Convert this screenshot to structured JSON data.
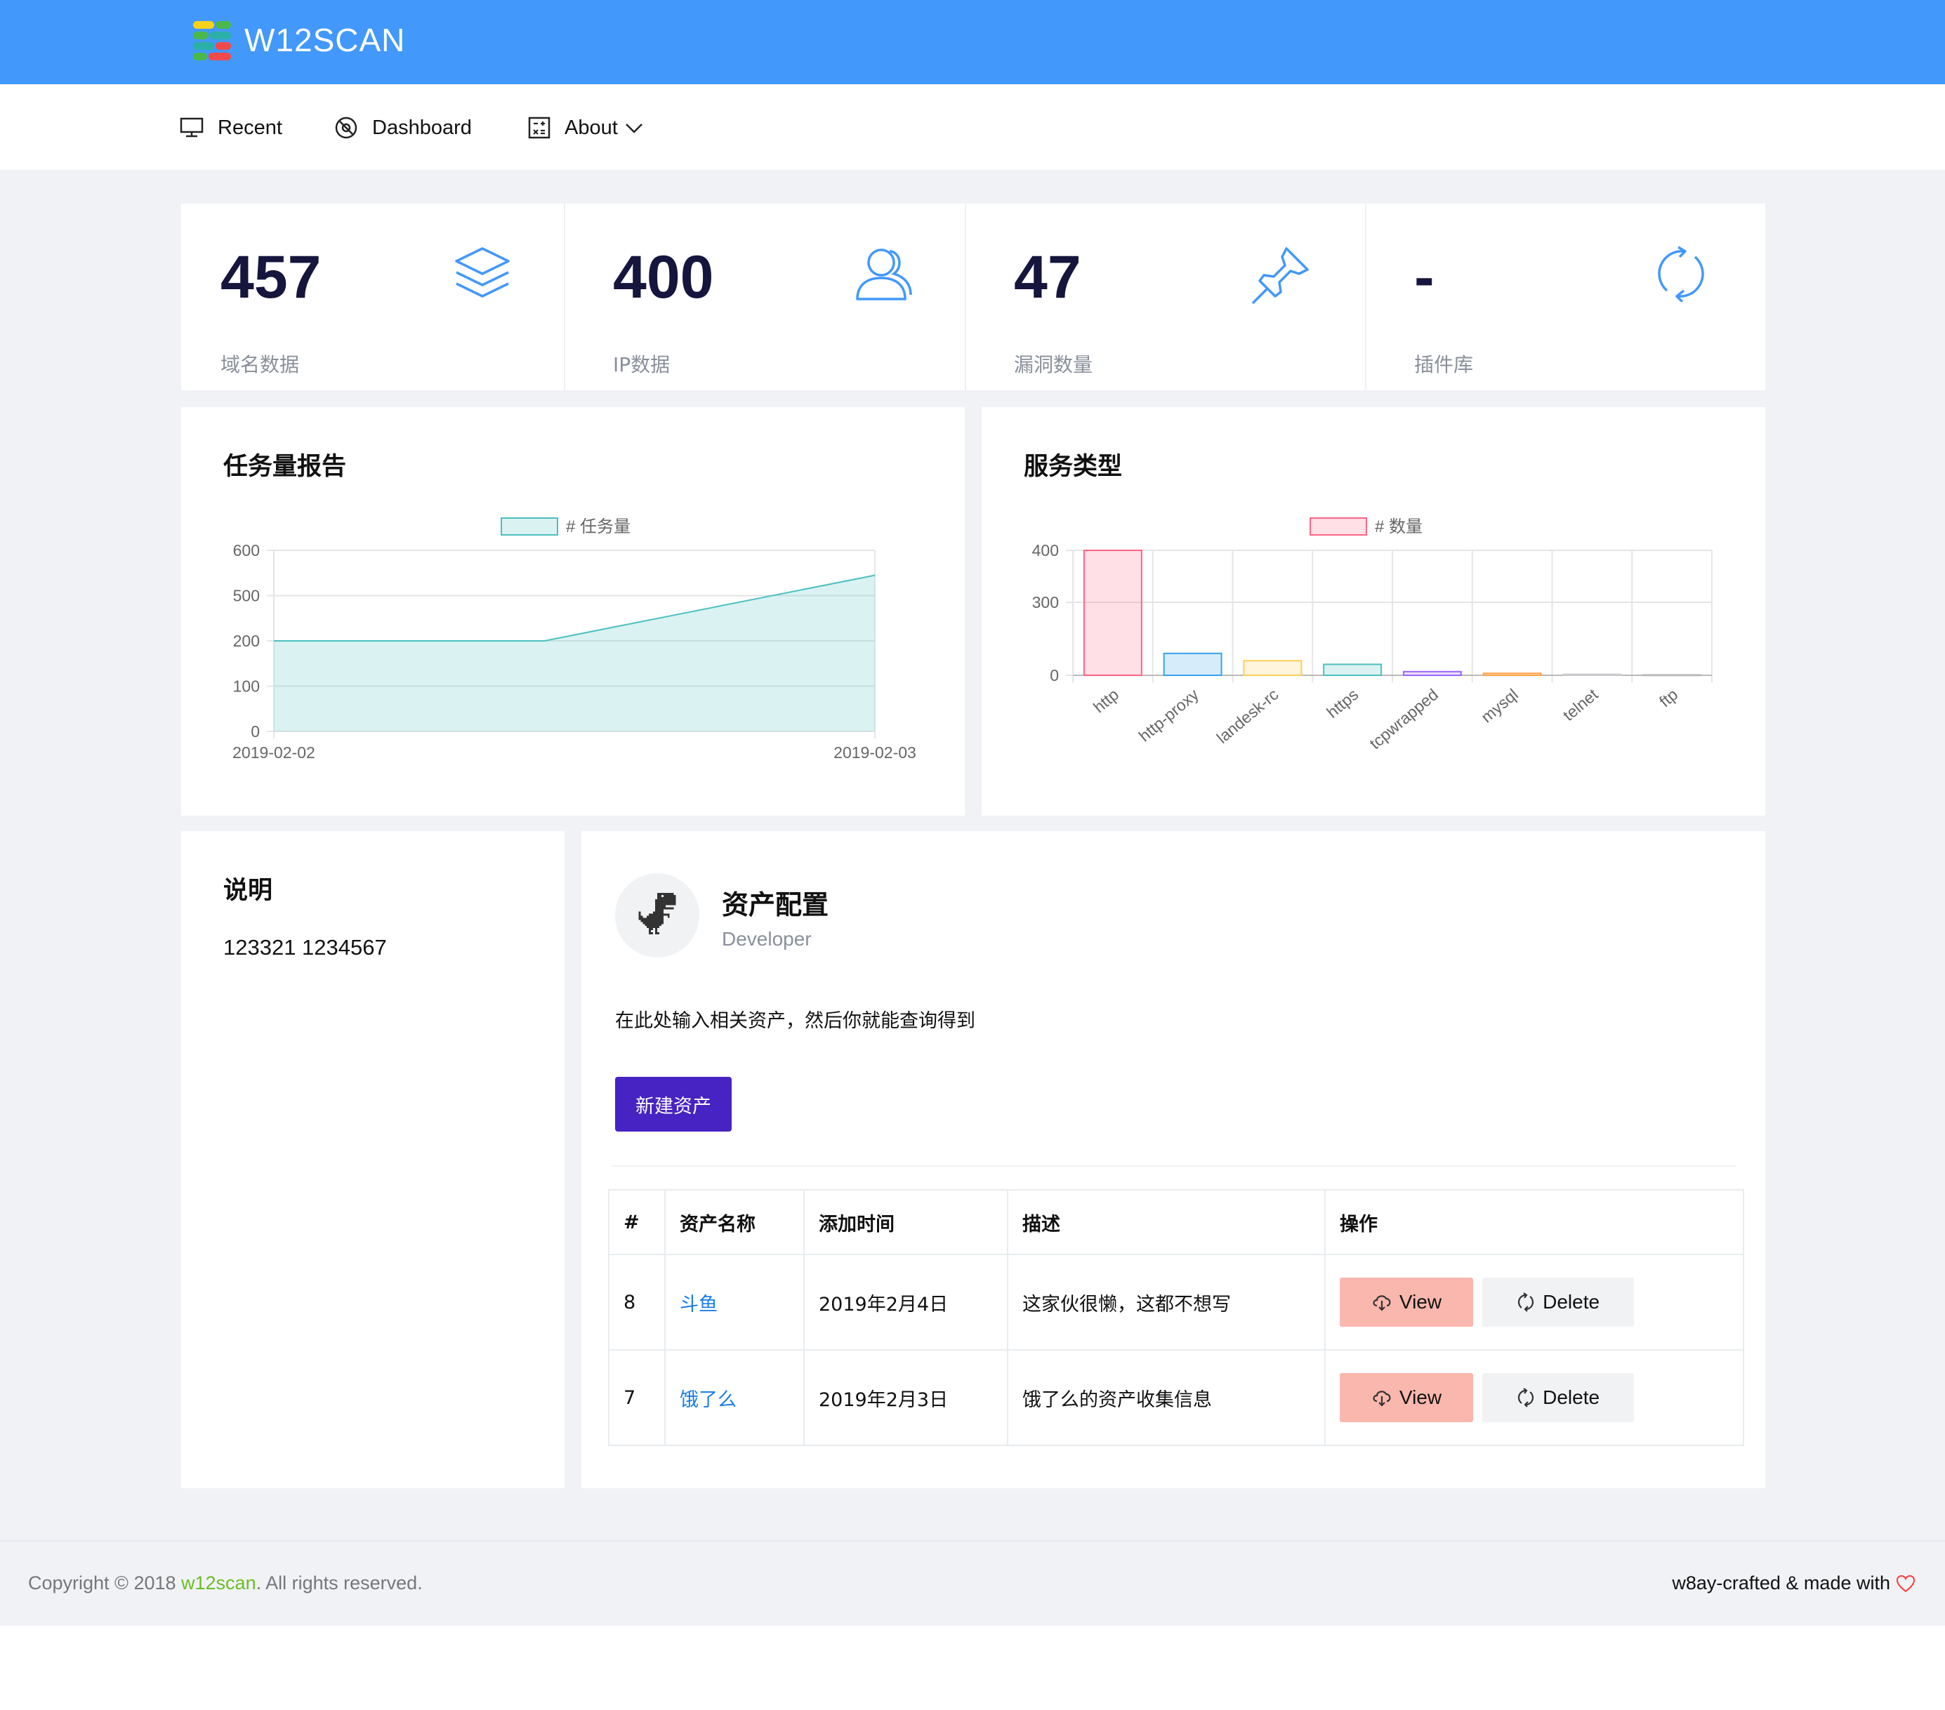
{
  "app": {
    "name": "W12SCAN"
  },
  "nav": {
    "items": [
      {
        "label": "Recent",
        "icon": "monitor-icon"
      },
      {
        "label": "Dashboard",
        "icon": "dashboard-icon"
      },
      {
        "label": "About",
        "icon": "calculator-icon"
      }
    ]
  },
  "stats": [
    {
      "value": "457",
      "label": "域名数据",
      "icon": "layers-icon"
    },
    {
      "value": "400",
      "label": "IP数据",
      "icon": "users-icon"
    },
    {
      "value": "47",
      "label": "漏洞数量",
      "icon": "pin-icon"
    },
    {
      "value": "-",
      "label": "插件库",
      "icon": "refresh-icon"
    }
  ],
  "charts": {
    "tasks_title": "任务量报告",
    "services_title": "服务类型"
  },
  "chart_data": [
    {
      "type": "area",
      "legend": [
        "# 任务量"
      ],
      "x": [
        "2019-02-02",
        "2019-02-03"
      ],
      "y_ticks": [
        "0",
        "100",
        "200",
        "500",
        "600"
      ],
      "series": [
        {
          "name": "# 任务量",
          "points": [
            [
              0,
              200
            ],
            [
              0.45,
              200
            ],
            [
              1,
              545
            ]
          ]
        }
      ],
      "color": "#4bc0c0",
      "grid": true,
      "legend_position": "top"
    },
    {
      "type": "bar",
      "legend": [
        "# 数量"
      ],
      "categories": [
        "http",
        "http-proxy",
        "landesk-rc",
        "https",
        "tcpwrapped",
        "mysql",
        "telnet",
        "ftp"
      ],
      "values": [
        400,
        90,
        60,
        45,
        15,
        8,
        4,
        2
      ],
      "y_ticks": [
        "0",
        "300",
        "400"
      ],
      "colors": [
        "#ff6384",
        "#36a2eb",
        "#ffce56",
        "#4bc0c0",
        "#9966ff",
        "#ff9f40",
        "#c9cbcf",
        "#bbbbbb"
      ],
      "grid": true,
      "legend_position": "top"
    }
  ],
  "notes": {
    "title": "说明",
    "text": "123321 1234567"
  },
  "assets": {
    "title": "资产配置",
    "subtitle": "Developer",
    "description": "在此处输入相关资产，然后你就能查询得到",
    "new_button": "新建资产",
    "columns": [
      "#",
      "资产名称",
      "添加时间",
      "描述",
      "操作"
    ],
    "rows": [
      {
        "id": "8",
        "name": "斗鱼",
        "date": "2019年2月4日",
        "desc": "这家伙很懒，这都不想写"
      },
      {
        "id": "7",
        "name": "饿了么",
        "date": "2019年2月3日",
        "desc": "饿了么的资产收集信息"
      }
    ],
    "view_label": "View",
    "delete_label": "Delete"
  },
  "footer": {
    "copyright_prefix": "Copyright © 2018 ",
    "brand": "w12scan",
    "copyright_suffix": ". All rights reserved.",
    "crafted": "w8ay-crafted & made with"
  },
  "colors": {
    "header": "#4298fb",
    "accent_icon": "#4298fb",
    "new_button": "#4623c2",
    "view_button": "#f9b7ae",
    "link": "#1a7de8",
    "footer_brand": "#6cbe24",
    "heart": "#ff3b3b"
  }
}
